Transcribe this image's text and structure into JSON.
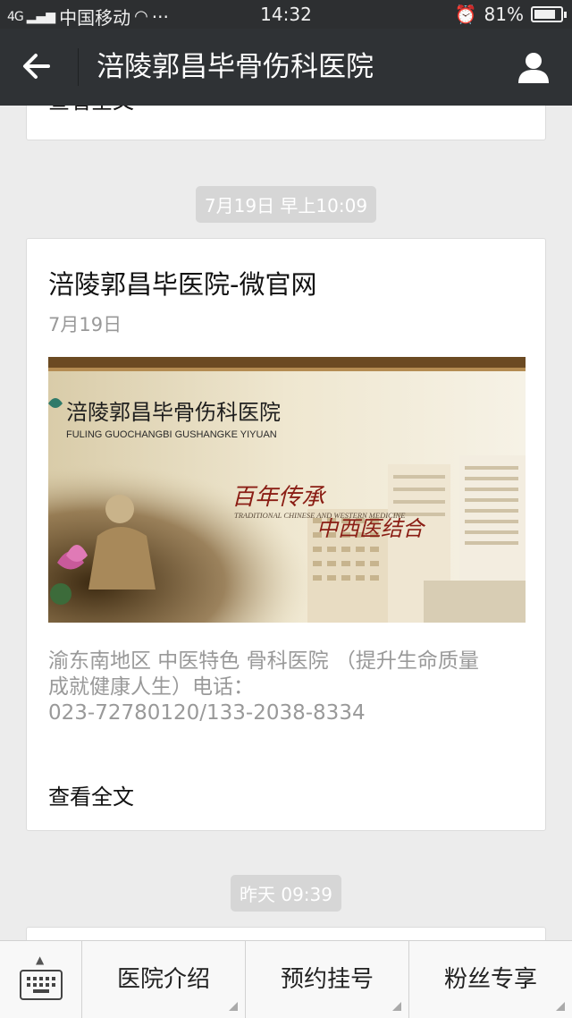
{
  "status_bar": {
    "network": "4G",
    "carrier": "中国移动",
    "dots": "···",
    "time": "14:32",
    "battery": "81%",
    "battery_level": 0.81
  },
  "header": {
    "title": "涪陵郭昌毕骨伤科医院",
    "back_icon": "back-arrow-icon",
    "profile_icon": "user-icon"
  },
  "messages": {
    "prev_read_more": "查看全文",
    "stamp1": "7月19日 早上10:09",
    "article": {
      "title": "涪陵郭昌毕医院-微官网",
      "date": "7月19日",
      "cover": {
        "hospital_name": "涪陵郭昌毕骨伤科医院",
        "hospital_pinyin": "FULING GUOCHANGBI GUSHANGKE YIYUAN",
        "slogan1": "百年传承",
        "slogan2": "中西医结合",
        "slogan_en": "TRADITIONAL CHINESE AND WESTERN MEDICINE"
      },
      "description_line1": "渝东南地区 中医特色 骨科医院 （提升生命质量",
      "description_line2": "成就健康人生）电话：",
      "description_line3": "023-72780120/133-2038-8334",
      "read_more": "查看全文"
    },
    "stamp2": "昨天 09:39"
  },
  "bottom_menu": {
    "keyboard_icon": "keyboard-icon",
    "items": [
      "医院介绍",
      "预约挂号",
      "粉丝专享"
    ]
  },
  "colors": {
    "header_bg": "#2f3235",
    "page_bg": "#ececec",
    "stamp_bg": "#d6d6d6"
  }
}
